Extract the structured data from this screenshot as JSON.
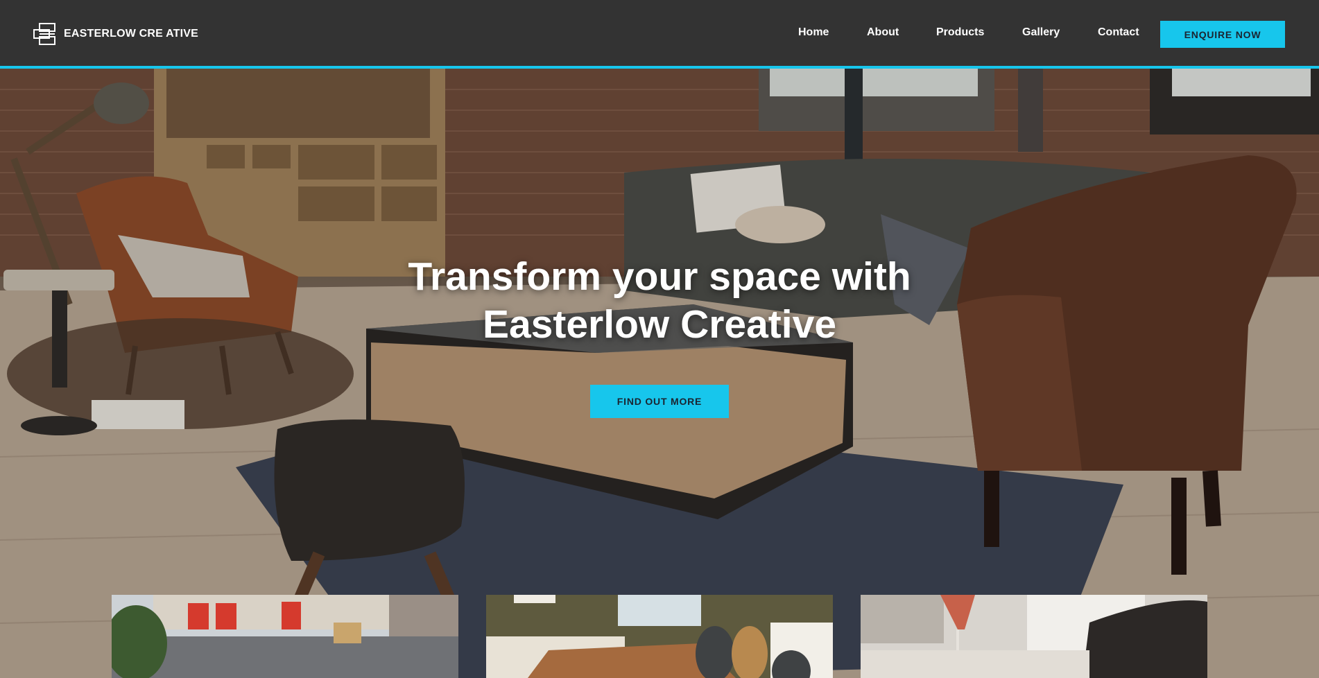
{
  "brand": {
    "name": "EASTERLOW CRE ATIVE",
    "logo_icon": "stacked-rectangles-logo-icon"
  },
  "nav": {
    "items": [
      "Home",
      "About",
      "Products",
      "Gallery",
      "Contact"
    ],
    "cta_label": "ENQUIRE NOW"
  },
  "hero": {
    "title_line1": "Transform your space with",
    "title_line2": "Easterlow Creative",
    "cta_label": "FIND OUT MORE",
    "image": "loft-living-room-with-leather-armchairs-sofa-and-crate-coffee-table"
  },
  "thumbnails": [
    {
      "image": "industrial-units-with-red-doors"
    },
    {
      "image": "wooden-dining-table-with-chairs"
    },
    {
      "image": "sofa-with-cushion-and-cocktail-glass"
    }
  ],
  "colors": {
    "header_bg": "#333333",
    "accent": "#17c6ec",
    "button_text": "#1b2430"
  }
}
